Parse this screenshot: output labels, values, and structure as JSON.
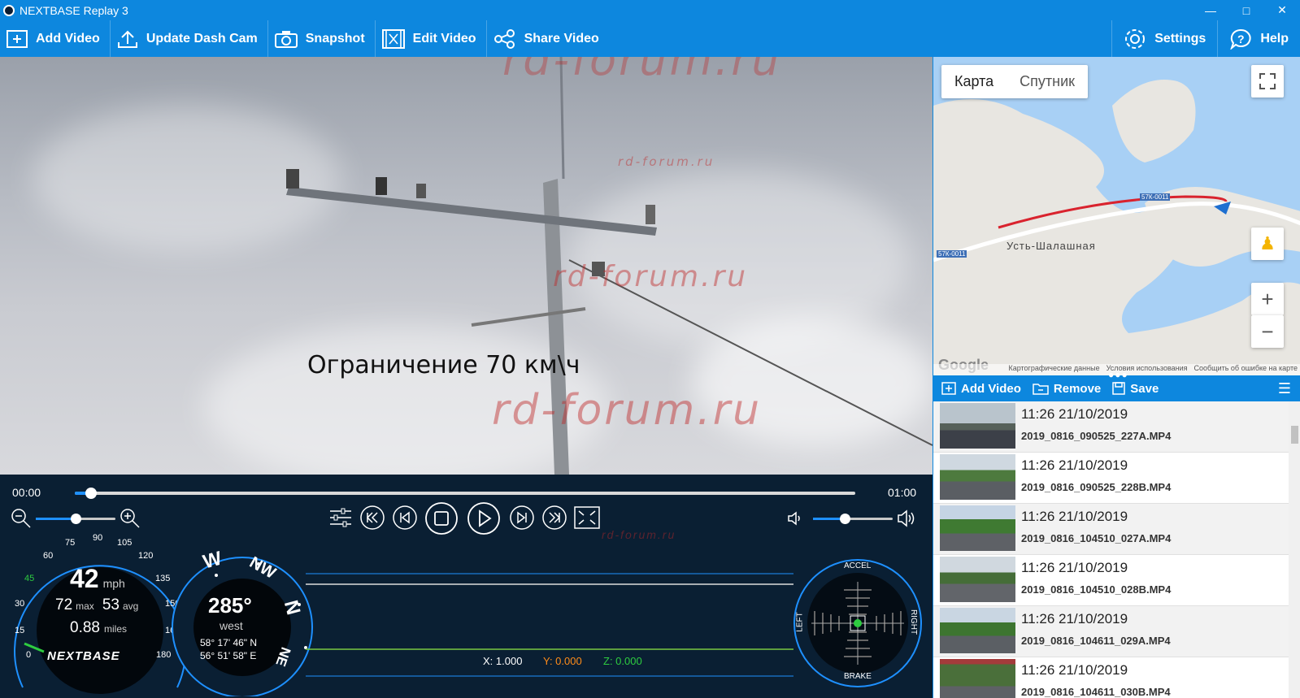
{
  "window": {
    "title": "NEXTBASE Replay 3"
  },
  "toolbar": {
    "add_video": "Add Video",
    "update_dash_cam": "Update Dash Cam",
    "snapshot": "Snapshot",
    "edit_video": "Edit Video",
    "share_video": "Share Video",
    "settings": "Settings",
    "help": "Help"
  },
  "video": {
    "subtitle": "Ограничение 70 км\\ч",
    "watermark": "rd-forum.ru"
  },
  "player": {
    "current_time": "00:00",
    "duration": "01:00",
    "progress": 0.02,
    "zoom_level": 0.5,
    "volume_level": 0.4
  },
  "speedometer": {
    "speed": "42",
    "speed_unit": "mph",
    "max": "72",
    "max_label": "max",
    "avg": "53",
    "avg_label": "avg",
    "distance": "0.88",
    "distance_unit": "miles",
    "ticks": [
      "0",
      "15",
      "30",
      "45",
      "60",
      "75",
      "90",
      "105",
      "120",
      "135",
      "150",
      "165",
      "180"
    ],
    "brand": "NEXTBASE"
  },
  "compass": {
    "heading": "285°",
    "direction": "west",
    "latitude": "58° 17' 46\" N",
    "longitude": "56° 51' 58\" E",
    "labels": [
      "W",
      "NW",
      "N",
      "NE"
    ]
  },
  "gsensor": {
    "x_label": "X: 1.000",
    "y_label": "Y: 0.000",
    "z_label": "Z: 0.000",
    "accel": "ACCEL",
    "brake": "BRAKE",
    "left": "LEFT",
    "right": "RIGHT"
  },
  "map": {
    "tab_map": "Карта",
    "tab_satellite": "Спутник",
    "place": "Усть-Шалашная",
    "road_badge_1": "57К-0011",
    "road_badge_2": "57К-0011",
    "google": "Google",
    "footer_data": "Картографические данные",
    "footer_terms": "Условия использования",
    "footer_report": "Сообщить об ошибке на карте"
  },
  "playlist_bar": {
    "add_video": "Add Video",
    "remove": "Remove",
    "save": "Save"
  },
  "playlist": [
    {
      "time": "11:26 21/10/2019",
      "file": "2019_0816_090525_227A.MP4"
    },
    {
      "time": "11:26 21/10/2019",
      "file": "2019_0816_090525_228B.MP4"
    },
    {
      "time": "11:26 21/10/2019",
      "file": "2019_0816_104510_027A.MP4"
    },
    {
      "time": "11:26 21/10/2019",
      "file": "2019_0816_104510_028B.MP4"
    },
    {
      "time": "11:26 21/10/2019",
      "file": "2019_0816_104611_029A.MP4"
    },
    {
      "time": "11:26 21/10/2019",
      "file": "2019_0816_104611_030B.MP4"
    }
  ],
  "colors": {
    "brand_blue": "#0d87de",
    "panel_dark": "#0a1f33",
    "route_red": "#d9232e"
  }
}
